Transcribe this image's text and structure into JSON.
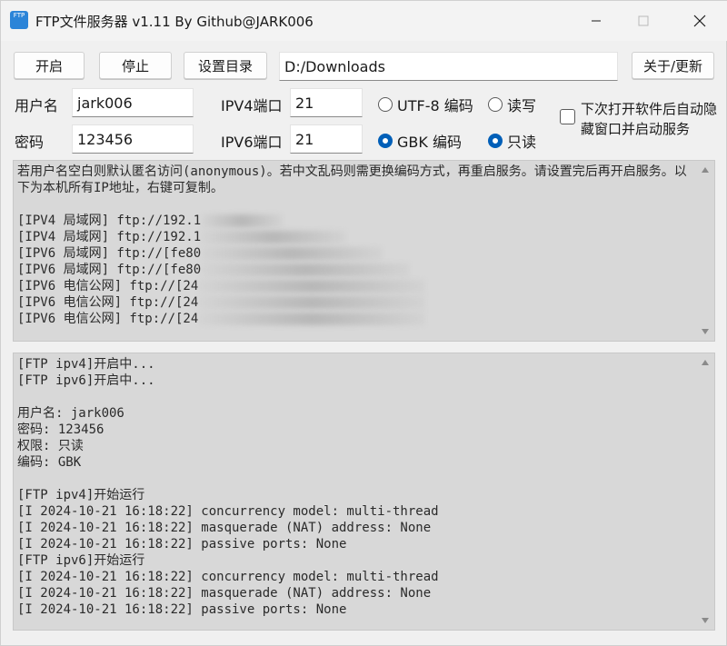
{
  "window": {
    "title": "FTP文件服务器 v1.11 By Github@JARK006",
    "icon_text": "FTP"
  },
  "toolbar": {
    "start_label": "开启",
    "stop_label": "停止",
    "set_dir_label": "设置目录",
    "directory_value": "D:/Downloads",
    "about_label": "关于/更新"
  },
  "form": {
    "username_label": "用户名",
    "username_value": "jark006",
    "password_label": "密码",
    "password_value": "123456",
    "ipv4_port_label": "IPV4端口",
    "ipv4_port_value": "21",
    "ipv6_port_label": "IPV6端口",
    "ipv6_port_value": "21",
    "encoding_utf8_label": "UTF-8 编码",
    "encoding_gbk_label": "GBK 编码",
    "encoding_selected": "GBK",
    "perm_rw_label": "读写",
    "perm_ro_label": "只读",
    "perm_selected": "只读",
    "autostart_label": "下次打开软件后自动隐藏窗口并启动服务",
    "autostart_checked": false
  },
  "info_box": {
    "intro": "若用户名空白则默认匿名访问(anonymous)。若中文乱码则需更换编码方式，再重启服务。请设置完后再开启服务。以下为本机所有IP地址，右键可复制。",
    "addresses": [
      "[IPV4 局域网] ftp://192.1",
      "[IPV4 局域网] ftp://192.1",
      "[IPV6 局域网] ftp://[fe80",
      "[IPV6 局域网] ftp://[fe80",
      "[IPV6 电信公网] ftp://[24",
      "[IPV6 电信公网] ftp://[24",
      "[IPV6 电信公网] ftp://[24"
    ]
  },
  "log_box": {
    "lines": [
      "[FTP ipv4]开启中...",
      "[FTP ipv6]开启中...",
      "",
      "用户名: jark006",
      "密码: 123456",
      "权限: 只读",
      "编码: GBK",
      "",
      "[FTP ipv4]开始运行",
      "[I 2024-10-21 16:18:22] concurrency model: multi-thread",
      "[I 2024-10-21 16:18:22] masquerade (NAT) address: None",
      "[I 2024-10-21 16:18:22] passive ports: None",
      "[FTP ipv6]开始运行",
      "[I 2024-10-21 16:18:22] concurrency model: multi-thread",
      "[I 2024-10-21 16:18:22] masquerade (NAT) address: None",
      "[I 2024-10-21 16:18:22] passive ports: None"
    ]
  },
  "icons": {
    "minimize": "minimize-icon",
    "maximize": "maximize-icon",
    "close": "close-icon",
    "scroll_up": "scroll-up-icon",
    "scroll_down": "scroll-down-icon"
  },
  "colors": {
    "accent": "#005fb8",
    "app_icon": "#2b84d8",
    "text_area_bg": "#d8d8d8"
  }
}
